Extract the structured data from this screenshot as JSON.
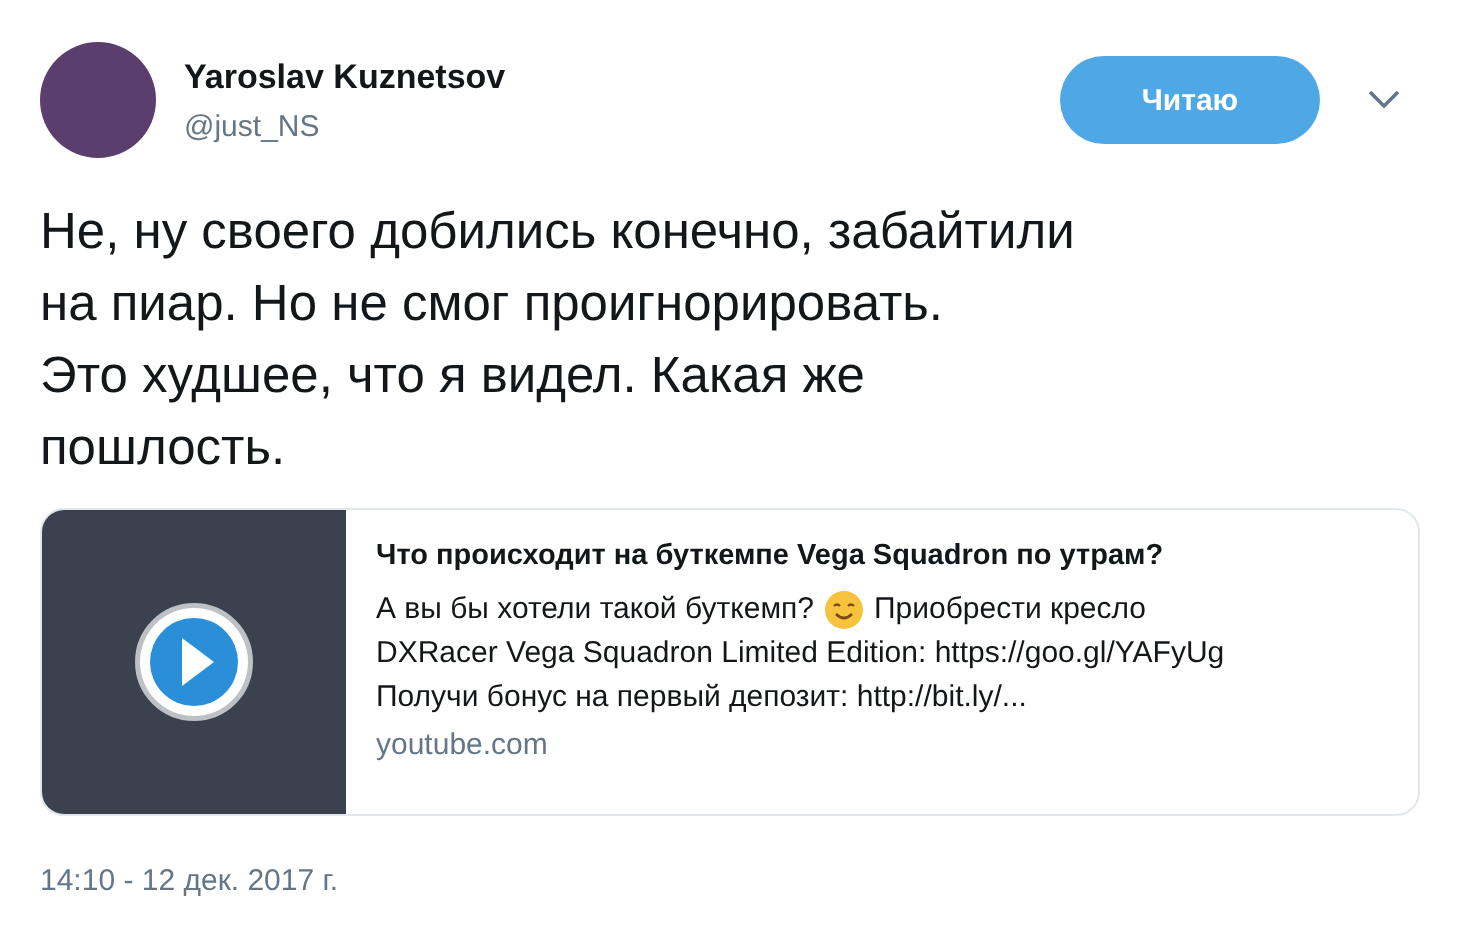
{
  "author": {
    "name": "Yaroslav Kuznetsov",
    "handle": "@just_NS"
  },
  "follow_button": {
    "label": "Читаю"
  },
  "tweet_text_lines": [
    "Не, ну своего добились конечно, забайтили",
    "на пиар. Но не смог проигнорировать.",
    "Это худшее, что я видел. Какая же",
    "пошлость."
  ],
  "card": {
    "title": "Что происходит на буткемпе Vega Squadron по утрам?",
    "description_before_emoji": "А вы бы хотели такой буткемп?",
    "description_after_emoji": "Приобрести кресло",
    "description_lines": [
      "DXRacer Vega Squadron Limited Edition: https://goo.gl/YAFyUg",
      "Получи бонус на первый депозит: http://bit.ly/..."
    ],
    "domain": "youtube.com"
  },
  "timestamp": "14:10 - 12 дек. 2017 г."
}
